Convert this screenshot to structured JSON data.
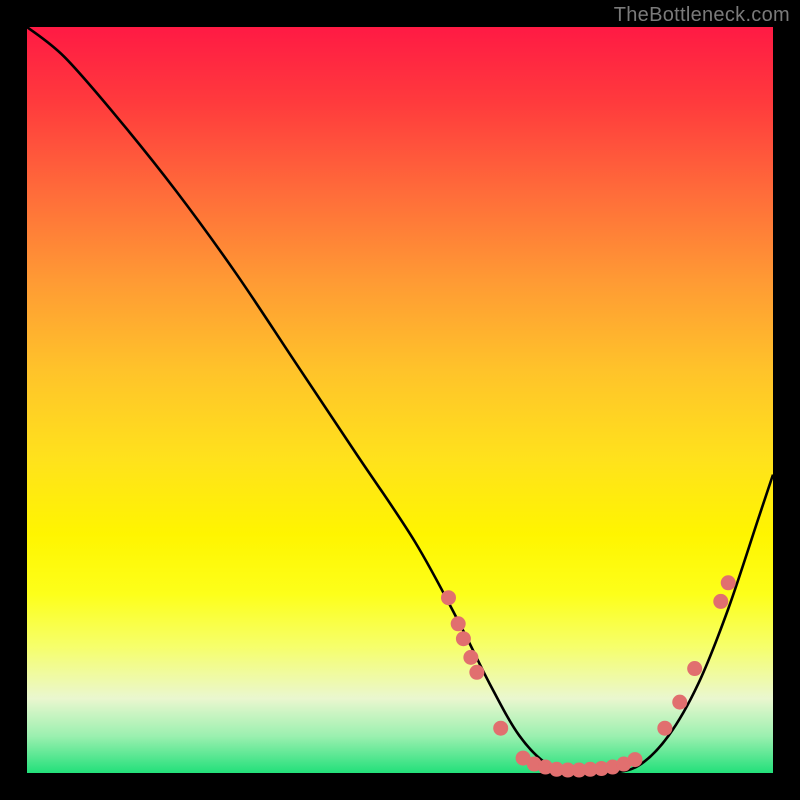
{
  "watermark": "TheBottleneck.com",
  "chart_data": {
    "type": "line",
    "title": "",
    "xlabel": "",
    "ylabel": "",
    "xlim": [
      0,
      100
    ],
    "ylim": [
      0,
      100
    ],
    "series": [
      {
        "name": "bottleneck-curve",
        "x": [
          0,
          5,
          12,
          20,
          28,
          36,
          44,
          52,
          58,
          62,
          66,
          70,
          74,
          78,
          82,
          86,
          90,
          94,
          98,
          100
        ],
        "y": [
          100,
          96,
          88,
          78,
          67,
          55,
          43,
          31,
          20,
          12,
          5,
          1,
          0,
          0,
          1,
          5,
          12,
          22,
          34,
          40
        ]
      }
    ],
    "markers": [
      {
        "x": 56.5,
        "y": 23.5
      },
      {
        "x": 57.8,
        "y": 20.0
      },
      {
        "x": 58.5,
        "y": 18.0
      },
      {
        "x": 59.5,
        "y": 15.5
      },
      {
        "x": 60.3,
        "y": 13.5
      },
      {
        "x": 63.5,
        "y": 6.0
      },
      {
        "x": 66.5,
        "y": 2.0
      },
      {
        "x": 68.0,
        "y": 1.2
      },
      {
        "x": 69.5,
        "y": 0.8
      },
      {
        "x": 71.0,
        "y": 0.5
      },
      {
        "x": 72.5,
        "y": 0.4
      },
      {
        "x": 74.0,
        "y": 0.4
      },
      {
        "x": 75.5,
        "y": 0.5
      },
      {
        "x": 77.0,
        "y": 0.6
      },
      {
        "x": 78.5,
        "y": 0.8
      },
      {
        "x": 80.0,
        "y": 1.2
      },
      {
        "x": 81.5,
        "y": 1.8
      },
      {
        "x": 85.5,
        "y": 6.0
      },
      {
        "x": 87.5,
        "y": 9.5
      },
      {
        "x": 89.5,
        "y": 14.0
      },
      {
        "x": 93.0,
        "y": 23.0
      },
      {
        "x": 94.0,
        "y": 25.5
      }
    ],
    "marker_color": "#e16f6f",
    "curve_color": "#000000"
  }
}
